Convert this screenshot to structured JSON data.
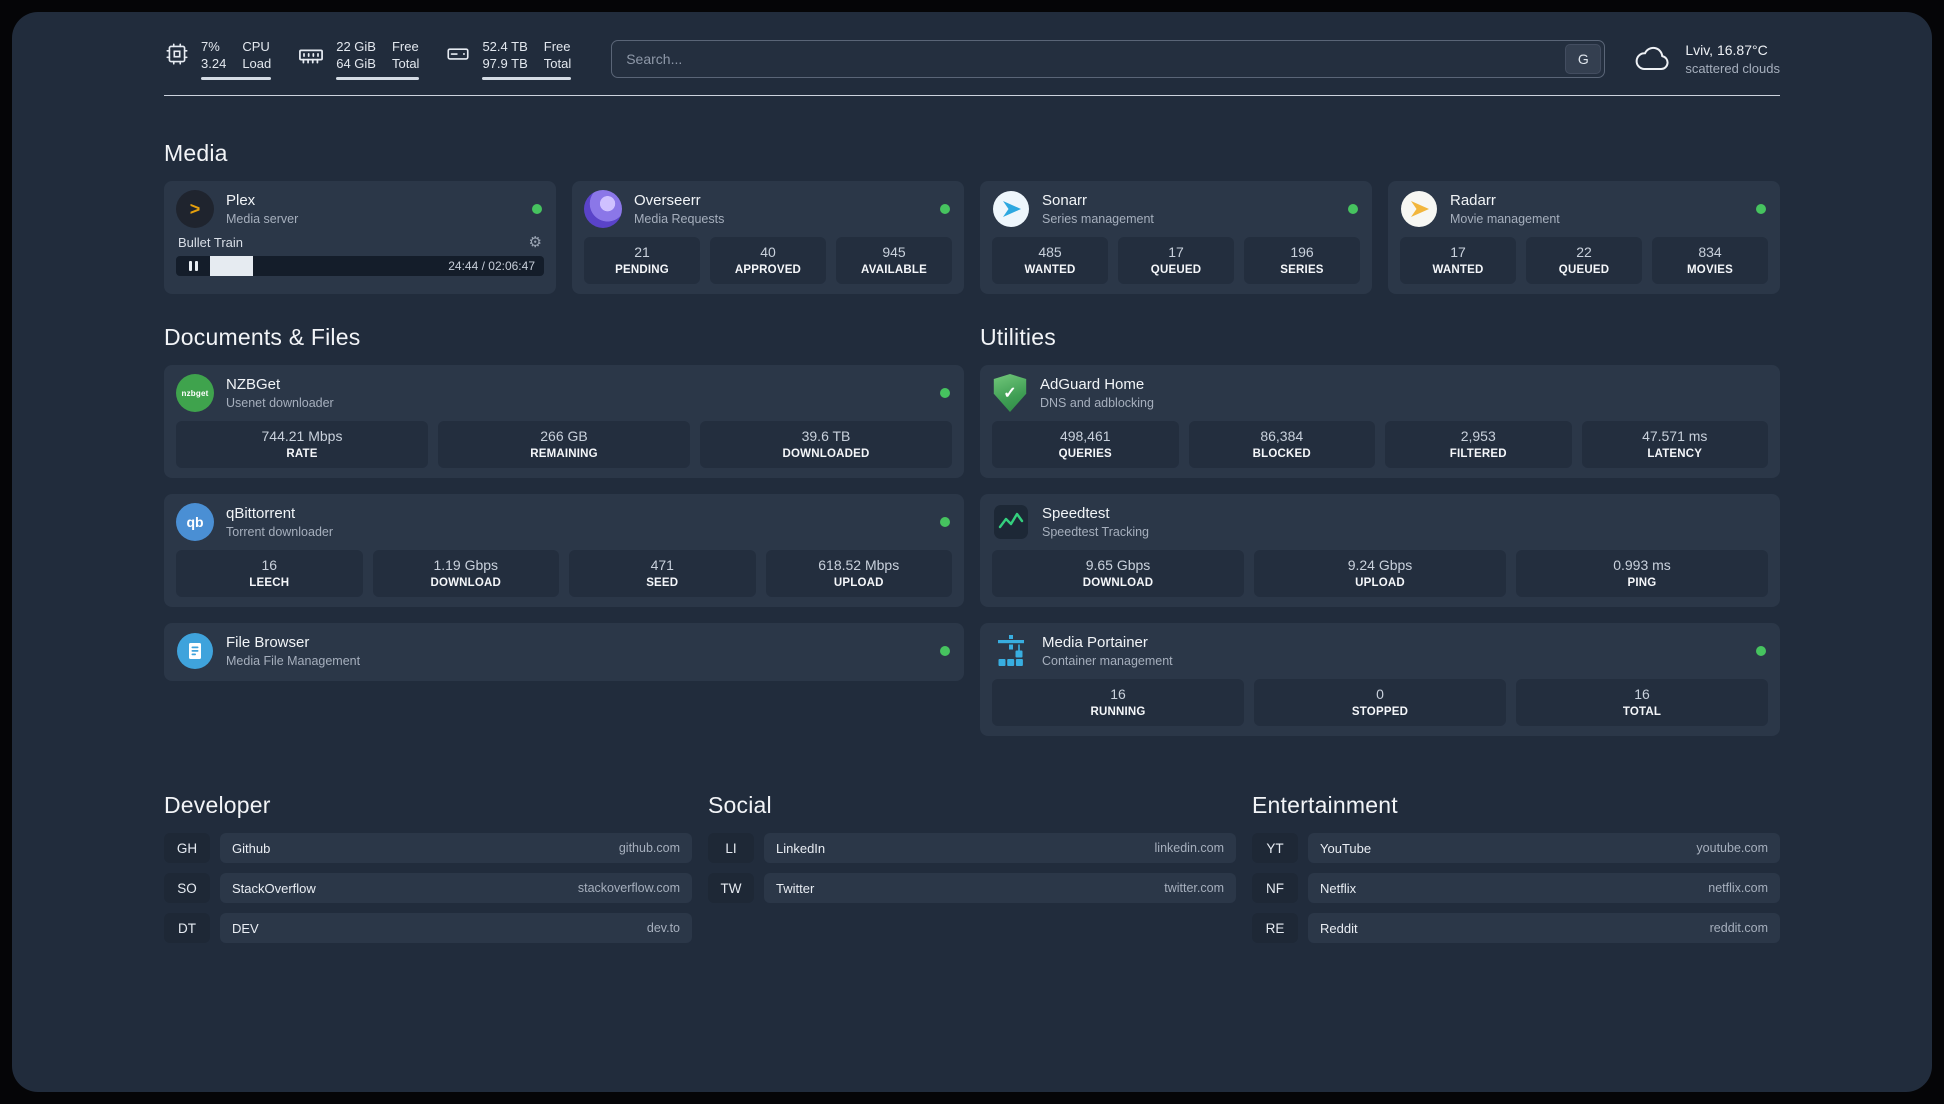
{
  "theme": {
    "panel_background": "#212c3c",
    "card_background": "#2b3748",
    "tile_background": "#232e3e",
    "status_online": "#46c35f"
  },
  "icons": {
    "plex": ">",
    "gear": "⚙",
    "check": "✓",
    "qbittorrent": "qb",
    "nzbget": "nzbget"
  },
  "topbar": {
    "cpu": {
      "value1": "7%",
      "label1": "CPU",
      "value2": "3.24",
      "label2": "Load"
    },
    "ram": {
      "value1": "22 GiB",
      "label1": "Free",
      "value2": "64 GiB",
      "label2": "Total"
    },
    "disk": {
      "value1": "52.4 TB",
      "label1": "Free",
      "value2": "97.9 TB",
      "label2": "Total"
    },
    "search": {
      "placeholder": "Search...",
      "engine_button": "G"
    },
    "weather": {
      "location": "Lviv, 16.87°C",
      "condition": "scattered clouds"
    }
  },
  "sections": {
    "media": {
      "title": "Media",
      "cards": [
        {
          "name": "Plex",
          "desc": "Media server",
          "status": "online",
          "player": {
            "title": "Bullet Train",
            "time": "24:44 / 02:06:47",
            "progress_percent": 13
          }
        },
        {
          "name": "Overseerr",
          "desc": "Media Requests",
          "status": "online",
          "stats": [
            {
              "value": "21",
              "label": "PENDING"
            },
            {
              "value": "40",
              "label": "APPROVED"
            },
            {
              "value": "945",
              "label": "AVAILABLE"
            }
          ]
        },
        {
          "name": "Sonarr",
          "desc": "Series management",
          "status": "online",
          "stats": [
            {
              "value": "485",
              "label": "WANTED"
            },
            {
              "value": "17",
              "label": "QUEUED"
            },
            {
              "value": "196",
              "label": "SERIES"
            }
          ]
        },
        {
          "name": "Radarr",
          "desc": "Movie management",
          "status": "online",
          "stats": [
            {
              "value": "17",
              "label": "WANTED"
            },
            {
              "value": "22",
              "label": "QUEUED"
            },
            {
              "value": "834",
              "label": "MOVIES"
            }
          ]
        }
      ]
    },
    "documents": {
      "title": "Documents & Files",
      "cards": [
        {
          "name": "NZBGet",
          "desc": "Usenet downloader",
          "status": "online",
          "stats": [
            {
              "value": "744.21 Mbps",
              "label": "RATE"
            },
            {
              "value": "266 GB",
              "label": "REMAINING"
            },
            {
              "value": "39.6 TB",
              "label": "DOWNLOADED"
            }
          ]
        },
        {
          "name": "qBittorrent",
          "desc": "Torrent downloader",
          "status": "online",
          "stats": [
            {
              "value": "16",
              "label": "LEECH"
            },
            {
              "value": "1.19 Gbps",
              "label": "DOWNLOAD"
            },
            {
              "value": "471",
              "label": "SEED"
            },
            {
              "value": "618.52 Mbps",
              "label": "UPLOAD"
            }
          ]
        },
        {
          "name": "File Browser",
          "desc": "Media File Management",
          "status": "online"
        }
      ]
    },
    "utilities": {
      "title": "Utilities",
      "cards": [
        {
          "name": "AdGuard Home",
          "desc": "DNS and adblocking",
          "stats": [
            {
              "value": "498,461",
              "label": "QUERIES"
            },
            {
              "value": "86,384",
              "label": "BLOCKED"
            },
            {
              "value": "2,953",
              "label": "FILTERED"
            },
            {
              "value": "47.571 ms",
              "label": "LATENCY"
            }
          ]
        },
        {
          "name": "Speedtest",
          "desc": "Speedtest Tracking",
          "stats": [
            {
              "value": "9.65 Gbps",
              "label": "DOWNLOAD"
            },
            {
              "value": "9.24 Gbps",
              "label": "UPLOAD"
            },
            {
              "value": "0.993 ms",
              "label": "PING"
            }
          ]
        },
        {
          "name": "Media Portainer",
          "desc": "Container management",
          "status": "online",
          "stats": [
            {
              "value": "16",
              "label": "RUNNING"
            },
            {
              "value": "0",
              "label": "STOPPED"
            },
            {
              "value": "16",
              "label": "TOTAL"
            }
          ]
        }
      ]
    },
    "developer": {
      "title": "Developer",
      "links": [
        {
          "abbr": "GH",
          "name": "Github",
          "domain": "github.com"
        },
        {
          "abbr": "SO",
          "name": "StackOverflow",
          "domain": "stackoverflow.com"
        },
        {
          "abbr": "DT",
          "name": "DEV",
          "domain": "dev.to"
        }
      ]
    },
    "social": {
      "title": "Social",
      "links": [
        {
          "abbr": "LI",
          "name": "LinkedIn",
          "domain": "linkedin.com"
        },
        {
          "abbr": "TW",
          "name": "Twitter",
          "domain": "twitter.com"
        }
      ]
    },
    "entertainment": {
      "title": "Entertainment",
      "links": [
        {
          "abbr": "YT",
          "name": "YouTube",
          "domain": "youtube.com"
        },
        {
          "abbr": "NF",
          "name": "Netflix",
          "domain": "netflix.com"
        },
        {
          "abbr": "RE",
          "name": "Reddit",
          "domain": "reddit.com"
        }
      ]
    }
  }
}
